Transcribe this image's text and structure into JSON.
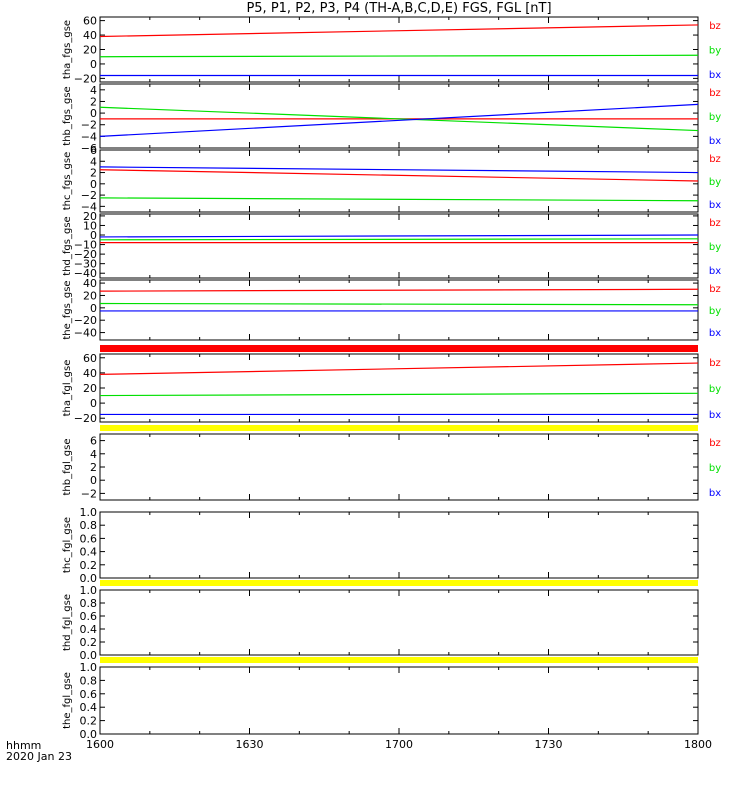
{
  "title": "P5, P1, P2, P3, P4 (TH-A,B,C,D,E) FGS, FGL [nT]",
  "footer": {
    "line1": "hhmm",
    "line2": "2020 Jan 23"
  },
  "x_ticks": [
    "1600",
    "1630",
    "1700",
    "1730",
    "1800"
  ],
  "colors": {
    "bx": "#0000ff",
    "by": "#00e000",
    "bz": "#ff0000",
    "red_bar": "#ff0000",
    "yellow_bar": "#ffff00"
  },
  "chart_data": [
    {
      "type": "line",
      "ylabel": "tha_fgs_gse",
      "yticks": [
        "60",
        "40",
        "20",
        "0",
        "−20"
      ],
      "ylim": [
        -25,
        65
      ],
      "x": [
        "16:00",
        "18:00"
      ],
      "series": [
        {
          "name": "bz",
          "values": [
            38,
            54
          ]
        },
        {
          "name": "by",
          "values": [
            10,
            12
          ]
        },
        {
          "name": "bx",
          "values": [
            -16,
            -16
          ]
        }
      ]
    },
    {
      "type": "line",
      "ylabel": "thb_fgs_gse",
      "yticks": [
        "4",
        "2",
        "0",
        "−2",
        "−4",
        "−6"
      ],
      "ylim": [
        -6,
        5
      ],
      "x": [
        "16:00",
        "18:00"
      ],
      "series": [
        {
          "name": "bz",
          "values": [
            -1,
            -1
          ]
        },
        {
          "name": "by",
          "values": [
            1,
            -3
          ]
        },
        {
          "name": "bx",
          "values": [
            -4,
            1.5
          ]
        }
      ]
    },
    {
      "type": "line",
      "ylabel": "thc_fgs_gse",
      "yticks": [
        "6",
        "4",
        "2",
        "0",
        "−2",
        "−4"
      ],
      "ylim": [
        -5,
        6
      ],
      "x": [
        "16:00",
        "18:00"
      ],
      "series": [
        {
          "name": "bz",
          "values": [
            2.5,
            0.5
          ]
        },
        {
          "name": "by",
          "values": [
            -2.5,
            -3
          ]
        },
        {
          "name": "bx",
          "values": [
            3,
            2
          ]
        }
      ]
    },
    {
      "type": "line",
      "ylabel": "thd_fgs_gse",
      "yticks": [
        "20",
        "10",
        "0",
        "−10",
        "−20",
        "−30",
        "−40"
      ],
      "ylim": [
        -45,
        22
      ],
      "x": [
        "16:00",
        "18:00"
      ],
      "series": [
        {
          "name": "bz",
          "values": [
            -8,
            -8
          ]
        },
        {
          "name": "by",
          "values": [
            -5,
            -4
          ]
        },
        {
          "name": "bx",
          "values": [
            -2,
            0
          ]
        }
      ]
    },
    {
      "type": "line",
      "ylabel": "the_fgs_gse",
      "yticks": [
        "40",
        "20",
        "0",
        "−20",
        "−40"
      ],
      "ylim": [
        -52,
        45
      ],
      "x": [
        "16:00",
        "18:00"
      ],
      "series": [
        {
          "name": "bz",
          "values": [
            27,
            30
          ]
        },
        {
          "name": "by",
          "values": [
            7,
            5
          ]
        },
        {
          "name": "bx",
          "values": [
            -5,
            -5
          ]
        }
      ]
    },
    {
      "type": "line",
      "ylabel": "tha_fgl_gse",
      "yticks": [
        "60",
        "40",
        "20",
        "0",
        "−20"
      ],
      "ylim": [
        -25,
        65
      ],
      "x": [
        "16:00",
        "18:00"
      ],
      "series": [
        {
          "name": "bz",
          "values": [
            38,
            53
          ]
        },
        {
          "name": "by",
          "values": [
            10,
            13
          ]
        },
        {
          "name": "bx",
          "values": [
            -15,
            -15
          ]
        }
      ]
    },
    {
      "type": "line",
      "ylabel": "thb_fgl_gse",
      "yticks": [
        "6",
        "4",
        "2",
        "0",
        "−2"
      ],
      "ylim": [
        -3,
        7
      ],
      "x": [],
      "series": [
        {
          "name": "bz",
          "values": []
        },
        {
          "name": "by",
          "values": []
        },
        {
          "name": "bx",
          "values": []
        }
      ]
    },
    {
      "type": "line",
      "ylabel": "thc_fgl_gse",
      "yticks": [
        "1.0",
        "0.8",
        "0.6",
        "0.4",
        "0.2",
        "0.0"
      ],
      "ylim": [
        0,
        1
      ],
      "x": [],
      "series": []
    },
    {
      "type": "line",
      "ylabel": "thd_fgl_gse",
      "yticks": [
        "1.0",
        "0.8",
        "0.6",
        "0.4",
        "0.2",
        "0.0"
      ],
      "ylim": [
        0,
        1
      ],
      "x": [],
      "series": []
    },
    {
      "type": "line",
      "ylabel": "the_fgl_gse",
      "yticks": [
        "1.0",
        "0.8",
        "0.6",
        "0.4",
        "0.2",
        "0.0"
      ],
      "ylim": [
        0,
        1
      ],
      "x": [],
      "series": []
    }
  ]
}
